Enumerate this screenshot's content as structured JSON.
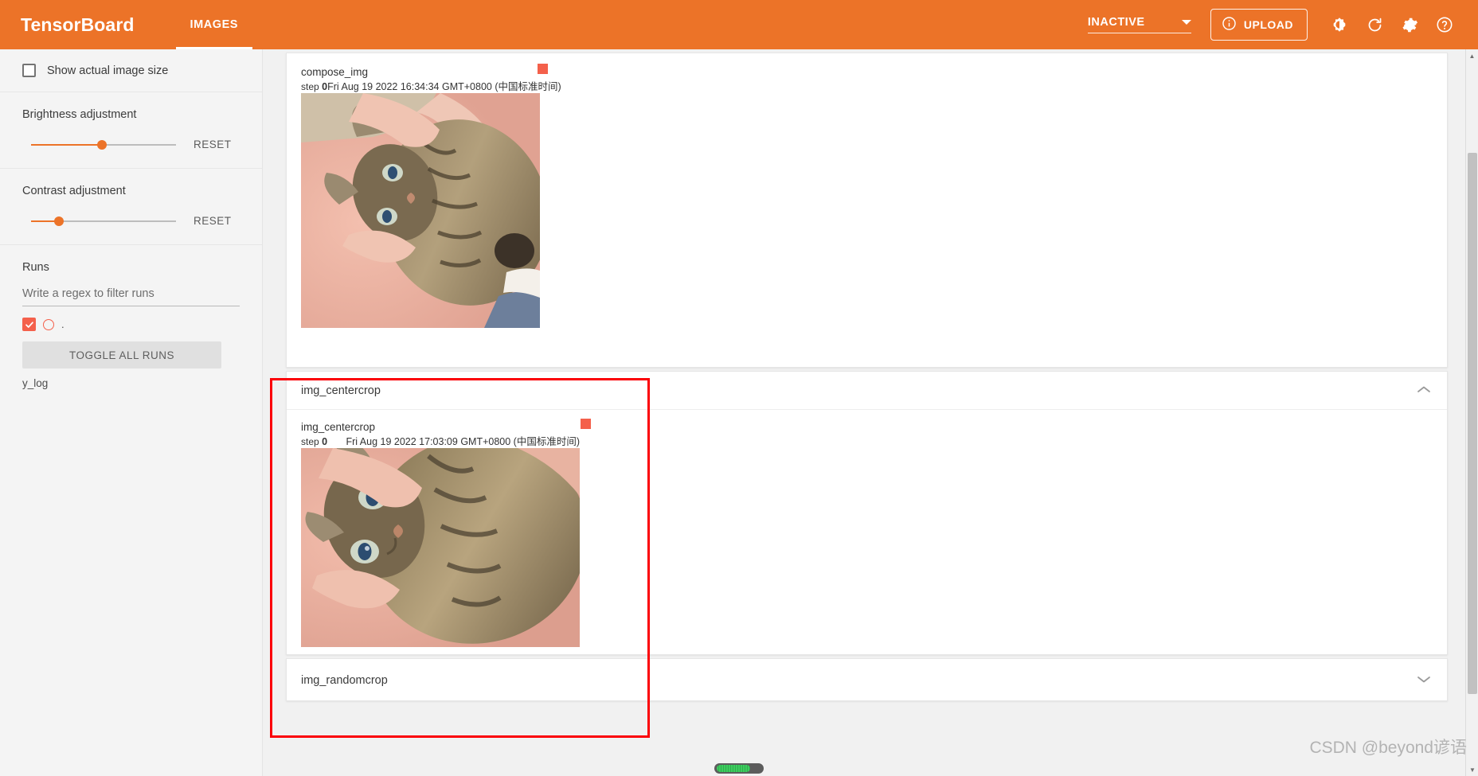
{
  "header": {
    "brand": "TensorBoard",
    "tabs": [
      {
        "label": "IMAGES",
        "active": true
      }
    ],
    "status": {
      "value": "INACTIVE"
    },
    "upload_label": "UPLOAD",
    "icons": [
      "info-icon",
      "brightness-icon",
      "refresh-icon",
      "gear-icon",
      "help-icon"
    ],
    "accent_color": "#ec7328"
  },
  "sidebar": {
    "show_actual_size": {
      "label": "Show actual image size",
      "checked": false
    },
    "brightness": {
      "label": "Brightness adjustment",
      "reset_label": "RESET",
      "value_pct": 49
    },
    "contrast": {
      "label": "Contrast adjustment",
      "reset_label": "RESET",
      "value_pct": 19
    },
    "runs": {
      "label": "Runs",
      "filter_placeholder": "Write a regex to filter runs",
      "filter_value": "",
      "items": [
        {
          "name": ".",
          "checked": true,
          "color": "#f4604b"
        }
      ],
      "toggle_label": "TOGGLE ALL RUNS",
      "footer_label": "y_log"
    }
  },
  "main": {
    "cards": [
      {
        "title": "compose_img",
        "expanded": true,
        "image": {
          "name": "compose_img",
          "step_label": "step",
          "step_value": "0",
          "timestamp": "Fri Aug 19 2022 16:34:34 GMT+0800 (中国标准时间)",
          "swatch_color": "#f4604b"
        }
      },
      {
        "title": "img_centercrop",
        "expanded": true,
        "highlighted": true,
        "image": {
          "name": "img_centercrop",
          "step_label": "step",
          "step_value": "0",
          "timestamp": "Fri Aug 19 2022 17:03:09 GMT+0800 (中国标准时间)",
          "swatch_color": "#f4604b"
        }
      },
      {
        "title": "img_randomcrop",
        "expanded": false
      }
    ]
  },
  "overlay": {
    "watermark": "CSDN @beyond谚语",
    "highlight_color": "#fb0007"
  }
}
